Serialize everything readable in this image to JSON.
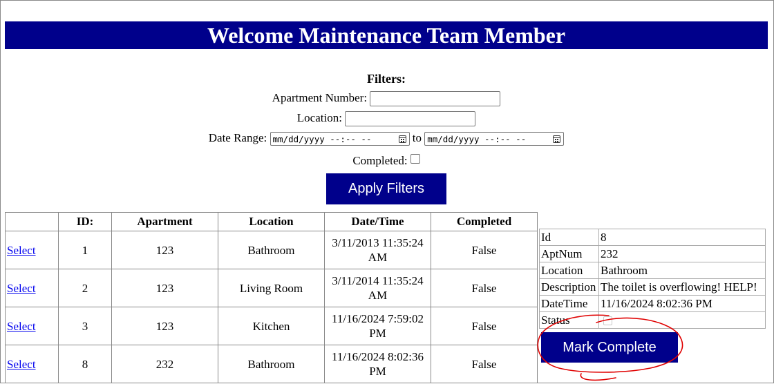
{
  "header": {
    "title": "Welcome Maintenance Team Member"
  },
  "filters": {
    "title": "Filters:",
    "apartment_label": "Apartment Number:",
    "apartment_value": "",
    "location_label": "Location:",
    "location_value": "",
    "date_range_label": "Date Range:",
    "date_from": "mm/dd/yyyy --:-- --",
    "date_sep": "to",
    "date_to": "mm/dd/yyyy --:-- --",
    "completed_label": "Completed:",
    "completed_checked": false,
    "apply_label": "Apply Filters"
  },
  "table": {
    "headers": [
      "",
      "ID:",
      "Apartment",
      "Location",
      "Date/Time",
      "Completed"
    ],
    "rows": [
      {
        "select": "Select",
        "id": "1",
        "apartment": "123",
        "location": "Bathroom",
        "datetime": "3/11/2013 11:35:24 AM",
        "completed": "False"
      },
      {
        "select": "Select",
        "id": "2",
        "apartment": "123",
        "location": "Living Room",
        "datetime": "3/11/2014 11:35:24 AM",
        "completed": "False"
      },
      {
        "select": "Select",
        "id": "3",
        "apartment": "123",
        "location": "Kitchen",
        "datetime": "11/16/2024 7:59:02 PM",
        "completed": "False"
      },
      {
        "select": "Select",
        "id": "8",
        "apartment": "232",
        "location": "Bathroom",
        "datetime": "11/16/2024 8:02:36 PM",
        "completed": "False"
      }
    ]
  },
  "detail": {
    "rows": [
      {
        "label": "Id",
        "value": "8"
      },
      {
        "label": "AptNum",
        "value": "232"
      },
      {
        "label": "Location",
        "value": "Bathroom"
      },
      {
        "label": "Description",
        "value": "The toilet is overflowing! HELP!"
      },
      {
        "label": "DateTime",
        "value": "11/16/2024 8:02:36 PM"
      },
      {
        "label": "Status",
        "value": ""
      }
    ],
    "status_checked": false,
    "mark_label": "Mark Complete"
  },
  "colors": {
    "accent": "#00008b",
    "annotation": "#e00000",
    "link": "#0000ee"
  }
}
